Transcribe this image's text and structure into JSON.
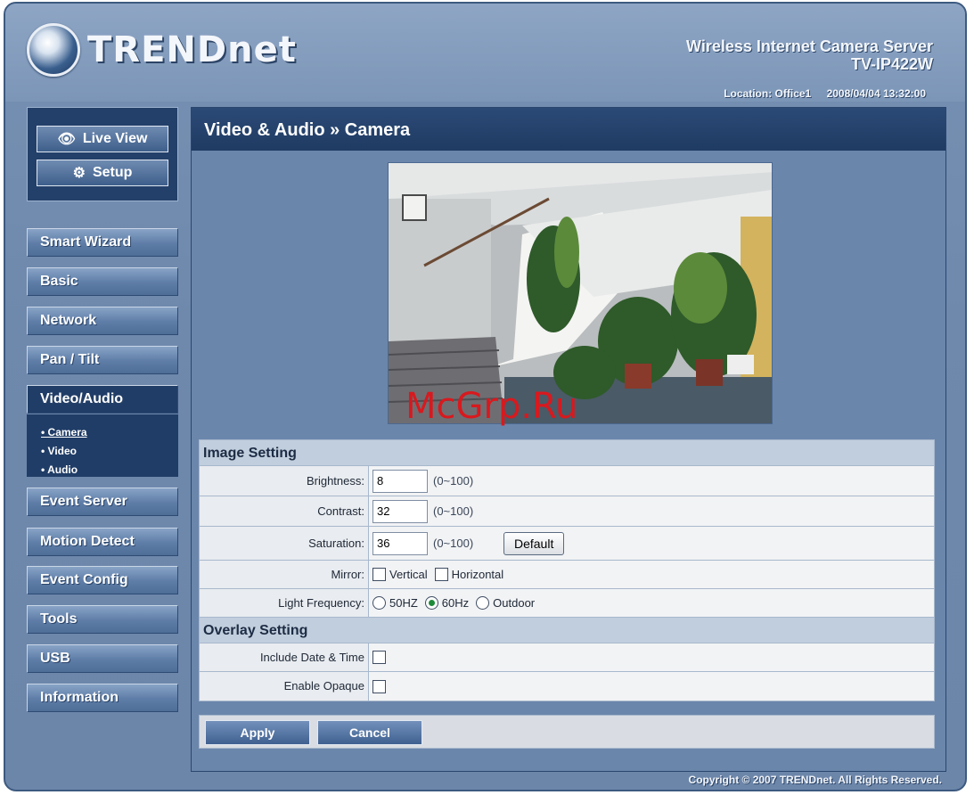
{
  "header": {
    "brand": "TRENDnet",
    "product_line": "Wireless Internet Camera Server",
    "model": "TV-IP422W",
    "location": "Location: Office1",
    "datetime": "2008/04/04 13:32:00"
  },
  "view_buttons": {
    "live_view": "Live View",
    "setup": "Setup"
  },
  "nav": {
    "items": [
      "Smart Wizard",
      "Basic",
      "Network",
      "Pan / Tilt",
      "Video/Audio",
      "Event Server",
      "Motion Detect",
      "Event Config",
      "Tools",
      "USB",
      "Information"
    ],
    "active": "Video/Audio",
    "submenu": [
      "• Camera",
      "• Video",
      "• Audio"
    ]
  },
  "main": {
    "title": "Video & Audio » Camera",
    "watermark": "McGrp.Ru"
  },
  "image_setting": {
    "heading": "Image Setting",
    "brightness": {
      "label": "Brightness:",
      "value": "8",
      "range": "(0~100)"
    },
    "contrast": {
      "label": "Contrast:",
      "value": "32",
      "range": "(0~100)"
    },
    "saturation": {
      "label": "Saturation:",
      "value": "36",
      "range": "(0~100)"
    },
    "default_label": "Default",
    "mirror": {
      "label": "Mirror:",
      "vertical": "Vertical",
      "horizontal": "Horizontal"
    },
    "light_frequency": {
      "label": "Light Frequency:",
      "opt1": "50HZ",
      "opt2": "60Hz",
      "opt3": "Outdoor",
      "selected": "60Hz"
    }
  },
  "overlay_setting": {
    "heading": "Overlay Setting",
    "include_date": "Include Date & Time",
    "enable_opaque": "Enable Opaque"
  },
  "actions": {
    "apply": "Apply",
    "cancel": "Cancel"
  },
  "footer": {
    "copyright": "Copyright © 2007 TRENDnet. All Rights Reserved."
  }
}
